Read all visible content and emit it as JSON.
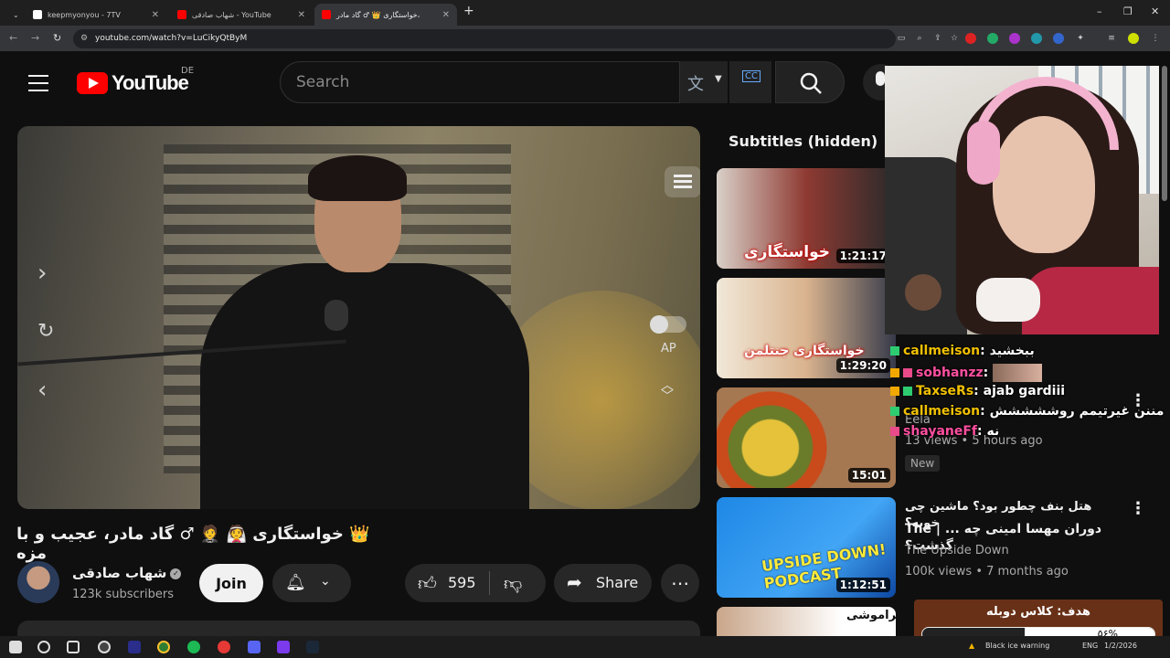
{
  "browser": {
    "tabs": [
      {
        "title": "keepmyonyou - 7TV"
      },
      {
        "title": "شهاب صادقی - YouTube"
      },
      {
        "title": "خواستگاری 👑 ♂ گاد مادر،"
      }
    ],
    "url": "youtube.com/watch?v=LuCikyQtByM"
  },
  "header": {
    "logo_text": "YouTube",
    "region": "DE",
    "search_placeholder": "Search"
  },
  "video": {
    "title": "👑 خواستگاری 👰 🤵 ♂ گاد مادر، عجیب و با مزه",
    "channel_name": "شهاب صادقی",
    "subscribers": "123k subscribers",
    "join_label": "Join",
    "likes": "595",
    "share_label": "Share",
    "autoplay_label": "AP"
  },
  "sidebar": {
    "chip": "Subtitles (hidden)",
    "items": [
      {
        "duration": "1:21:17",
        "thumb_text": "خواستگاری"
      },
      {
        "duration": "1:29:20",
        "thumb_text": "خواستگاری جنتلمن"
      },
      {
        "duration": "15:01",
        "channel": "Eela",
        "meta": "13 views • 5 hours ago",
        "badge": "New"
      },
      {
        "duration": "1:12:51",
        "title_line1": "هتل بنف چطور بود؟ ماشین چی خوبه؟",
        "title_line2": "The | ... دوران مهسا امینی چه گذشت؟",
        "channel": "The Upside Down",
        "meta": "100k views • 7 months ago",
        "thumb_text": "UPSIDE DOWN! PODCAST"
      },
      {
        "title_line1": "فراموشی"
      }
    ]
  },
  "chat": [
    {
      "user": "callmeison",
      "message": "ببخشید",
      "color": "#f0c000"
    },
    {
      "user": "sobhanzz",
      "message": "",
      "color": "#ff4fa0"
    },
    {
      "user": "TaxseRs",
      "message": "ajab gardiii",
      "color": "#f0c000"
    },
    {
      "user": "callmeison",
      "message": "مننن غیرتیمم روششششش",
      "color": "#f0c000"
    },
    {
      "user": "shayaneFf",
      "message": "نه",
      "color": "#ff4fa0"
    }
  ],
  "goal": {
    "text": "هدف: کلاس دوبله",
    "percent_text": "۵۶%",
    "fraction": 0.56
  },
  "taskbar": {
    "weather": "Black ice warning",
    "lang": "ENG",
    "time": "1/2/2026"
  }
}
